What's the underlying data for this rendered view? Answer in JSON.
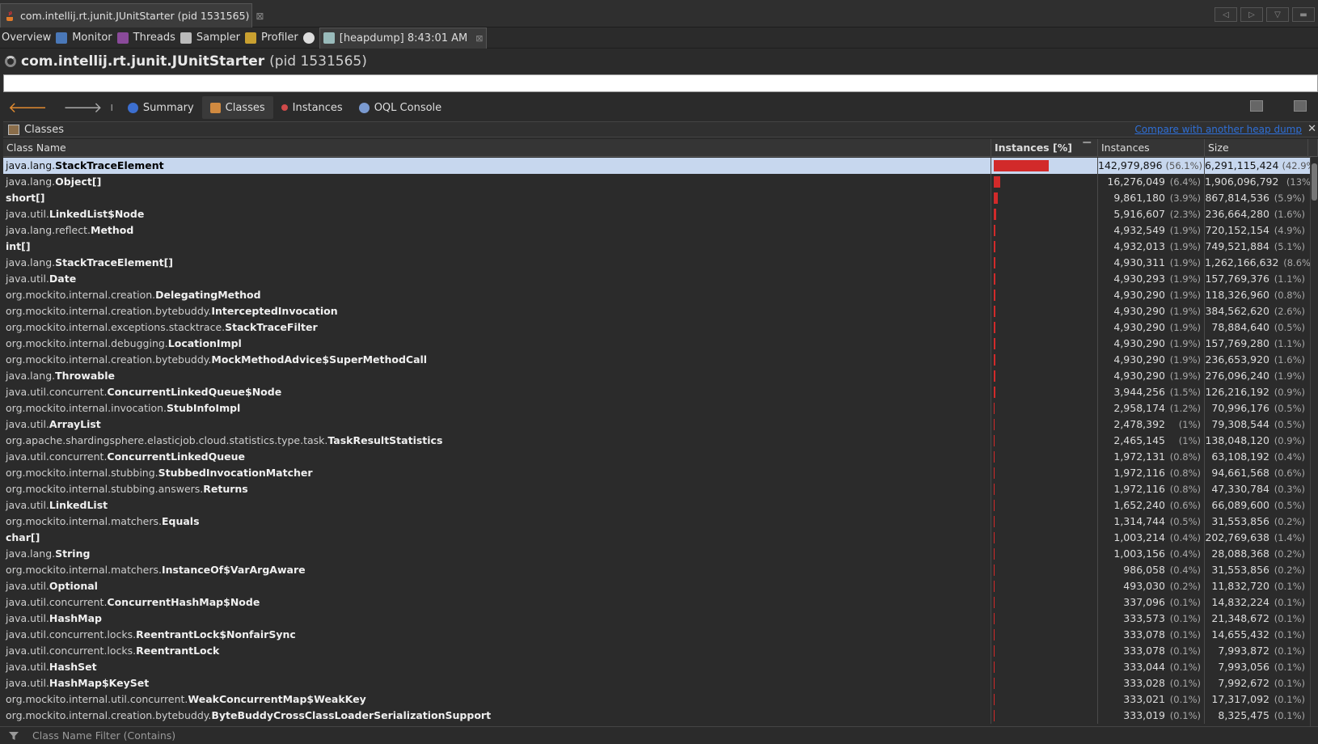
{
  "window_tab": {
    "title": "com.intellij.rt.junit.JUnitStarter (pid 1531565)",
    "close": "⊠"
  },
  "subtabs": [
    {
      "label": "Overview",
      "icon": "overview-icon"
    },
    {
      "label": "Monitor",
      "icon": "monitor-icon"
    },
    {
      "label": "Threads",
      "icon": "threads-icon"
    },
    {
      "label": "Sampler",
      "icon": "sampler-icon"
    },
    {
      "label": "Profiler",
      "icon": "profiler-icon"
    },
    {
      "label": "[heapdump] 8:43:01 AM",
      "icon": "heapdump-icon",
      "close": "⊠"
    }
  ],
  "title": {
    "main": "com.intellij.rt.junit.JUnitStarter",
    "pid": "(pid 1531565)"
  },
  "toolbar": {
    "sep": "I",
    "summary": "Summary",
    "classes": "Classes",
    "instances": "Instances",
    "oql": "OQL Console"
  },
  "classes_panel": {
    "title": "Classes",
    "compare_link": "Compare with another heap dump",
    "close": "✕"
  },
  "columns": {
    "name": "Class Name",
    "bar": "Instances [%]",
    "instances": "Instances",
    "size": "Size",
    "sort": "▔"
  },
  "filter_placeholder": "Class Name Filter (Contains)",
  "accent_color": "#d22a2a",
  "rows": [
    {
      "pkg": "java.lang.",
      "cls": "StackTraceElement",
      "pct": 56.1,
      "inst": "142,979,896",
      "ipct": "(56.1%)",
      "size": "6,291,115,424",
      "spct": "(42.9%)"
    },
    {
      "pkg": "java.lang.",
      "cls": "Object[]",
      "pct": 6.4,
      "inst": "16,276,049",
      "ipct": "(6.4%)",
      "size": "1,906,096,792",
      "spct": "(13%)"
    },
    {
      "pkg": "",
      "cls": "short[]",
      "pct": 3.9,
      "inst": "9,861,180",
      "ipct": "(3.9%)",
      "size": "867,814,536",
      "spct": "(5.9%)"
    },
    {
      "pkg": "java.util.",
      "cls": "LinkedList$Node",
      "pct": 2.3,
      "inst": "5,916,607",
      "ipct": "(2.3%)",
      "size": "236,664,280",
      "spct": "(1.6%)"
    },
    {
      "pkg": "java.lang.reflect.",
      "cls": "Method",
      "pct": 1.9,
      "inst": "4,932,549",
      "ipct": "(1.9%)",
      "size": "720,152,154",
      "spct": "(4.9%)"
    },
    {
      "pkg": "",
      "cls": "int[]",
      "pct": 1.9,
      "inst": "4,932,013",
      "ipct": "(1.9%)",
      "size": "749,521,884",
      "spct": "(5.1%)"
    },
    {
      "pkg": "java.lang.",
      "cls": "StackTraceElement[]",
      "pct": 1.9,
      "inst": "4,930,311",
      "ipct": "(1.9%)",
      "size": "1,262,166,632",
      "spct": "(8.6%)"
    },
    {
      "pkg": "java.util.",
      "cls": "Date",
      "pct": 1.9,
      "inst": "4,930,293",
      "ipct": "(1.9%)",
      "size": "157,769,376",
      "spct": "(1.1%)"
    },
    {
      "pkg": "org.mockito.internal.creation.",
      "cls": "DelegatingMethod",
      "pct": 1.9,
      "inst": "4,930,290",
      "ipct": "(1.9%)",
      "size": "118,326,960",
      "spct": "(0.8%)"
    },
    {
      "pkg": "org.mockito.internal.creation.bytebuddy.",
      "cls": "InterceptedInvocation",
      "pct": 1.9,
      "inst": "4,930,290",
      "ipct": "(1.9%)",
      "size": "384,562,620",
      "spct": "(2.6%)"
    },
    {
      "pkg": "org.mockito.internal.exceptions.stacktrace.",
      "cls": "StackTraceFilter",
      "pct": 1.9,
      "inst": "4,930,290",
      "ipct": "(1.9%)",
      "size": "78,884,640",
      "spct": "(0.5%)"
    },
    {
      "pkg": "org.mockito.internal.debugging.",
      "cls": "LocationImpl",
      "pct": 1.9,
      "inst": "4,930,290",
      "ipct": "(1.9%)",
      "size": "157,769,280",
      "spct": "(1.1%)"
    },
    {
      "pkg": "org.mockito.internal.creation.bytebuddy.",
      "cls": "MockMethodAdvice$SuperMethodCall",
      "pct": 1.9,
      "inst": "4,930,290",
      "ipct": "(1.9%)",
      "size": "236,653,920",
      "spct": "(1.6%)"
    },
    {
      "pkg": "java.lang.",
      "cls": "Throwable",
      "pct": 1.9,
      "inst": "4,930,290",
      "ipct": "(1.9%)",
      "size": "276,096,240",
      "spct": "(1.9%)"
    },
    {
      "pkg": "java.util.concurrent.",
      "cls": "ConcurrentLinkedQueue$Node",
      "pct": 1.5,
      "inst": "3,944,256",
      "ipct": "(1.5%)",
      "size": "126,216,192",
      "spct": "(0.9%)"
    },
    {
      "pkg": "org.mockito.internal.invocation.",
      "cls": "StubInfoImpl",
      "pct": 1.2,
      "inst": "2,958,174",
      "ipct": "(1.2%)",
      "size": "70,996,176",
      "spct": "(0.5%)"
    },
    {
      "pkg": "java.util.",
      "cls": "ArrayList",
      "pct": 1.0,
      "inst": "2,478,392",
      "ipct": "(1%)",
      "size": "79,308,544",
      "spct": "(0.5%)"
    },
    {
      "pkg": "org.apache.shardingsphere.elasticjob.cloud.statistics.type.task.",
      "cls": "TaskResultStatistics",
      "pct": 1.0,
      "inst": "2,465,145",
      "ipct": "(1%)",
      "size": "138,048,120",
      "spct": "(0.9%)"
    },
    {
      "pkg": "java.util.concurrent.",
      "cls": "ConcurrentLinkedQueue",
      "pct": 0.8,
      "inst": "1,972,131",
      "ipct": "(0.8%)",
      "size": "63,108,192",
      "spct": "(0.4%)"
    },
    {
      "pkg": "org.mockito.internal.stubbing.",
      "cls": "StubbedInvocationMatcher",
      "pct": 0.8,
      "inst": "1,972,116",
      "ipct": "(0.8%)",
      "size": "94,661,568",
      "spct": "(0.6%)"
    },
    {
      "pkg": "org.mockito.internal.stubbing.answers.",
      "cls": "Returns",
      "pct": 0.8,
      "inst": "1,972,116",
      "ipct": "(0.8%)",
      "size": "47,330,784",
      "spct": "(0.3%)"
    },
    {
      "pkg": "java.util.",
      "cls": "LinkedList",
      "pct": 0.6,
      "inst": "1,652,240",
      "ipct": "(0.6%)",
      "size": "66,089,600",
      "spct": "(0.5%)"
    },
    {
      "pkg": "org.mockito.internal.matchers.",
      "cls": "Equals",
      "pct": 0.5,
      "inst": "1,314,744",
      "ipct": "(0.5%)",
      "size": "31,553,856",
      "spct": "(0.2%)"
    },
    {
      "pkg": "",
      "cls": "char[]",
      "pct": 0.4,
      "inst": "1,003,214",
      "ipct": "(0.4%)",
      "size": "202,769,638",
      "spct": "(1.4%)"
    },
    {
      "pkg": "java.lang.",
      "cls": "String",
      "pct": 0.4,
      "inst": "1,003,156",
      "ipct": "(0.4%)",
      "size": "28,088,368",
      "spct": "(0.2%)"
    },
    {
      "pkg": "org.mockito.internal.matchers.",
      "cls": "InstanceOf$VarArgAware",
      "pct": 0.4,
      "inst": "986,058",
      "ipct": "(0.4%)",
      "size": "31,553,856",
      "spct": "(0.2%)"
    },
    {
      "pkg": "java.util.",
      "cls": "Optional",
      "pct": 0.2,
      "inst": "493,030",
      "ipct": "(0.2%)",
      "size": "11,832,720",
      "spct": "(0.1%)"
    },
    {
      "pkg": "java.util.concurrent.",
      "cls": "ConcurrentHashMap$Node",
      "pct": 0.1,
      "inst": "337,096",
      "ipct": "(0.1%)",
      "size": "14,832,224",
      "spct": "(0.1%)"
    },
    {
      "pkg": "java.util.",
      "cls": "HashMap",
      "pct": 0.1,
      "inst": "333,573",
      "ipct": "(0.1%)",
      "size": "21,348,672",
      "spct": "(0.1%)"
    },
    {
      "pkg": "java.util.concurrent.locks.",
      "cls": "ReentrantLock$NonfairSync",
      "pct": 0.1,
      "inst": "333,078",
      "ipct": "(0.1%)",
      "size": "14,655,432",
      "spct": "(0.1%)"
    },
    {
      "pkg": "java.util.concurrent.locks.",
      "cls": "ReentrantLock",
      "pct": 0.1,
      "inst": "333,078",
      "ipct": "(0.1%)",
      "size": "7,993,872",
      "spct": "(0.1%)"
    },
    {
      "pkg": "java.util.",
      "cls": "HashSet",
      "pct": 0.1,
      "inst": "333,044",
      "ipct": "(0.1%)",
      "size": "7,993,056",
      "spct": "(0.1%)"
    },
    {
      "pkg": "java.util.",
      "cls": "HashMap$KeySet",
      "pct": 0.1,
      "inst": "333,028",
      "ipct": "(0.1%)",
      "size": "7,992,672",
      "spct": "(0.1%)"
    },
    {
      "pkg": "org.mockito.internal.util.concurrent.",
      "cls": "WeakConcurrentMap$WeakKey",
      "pct": 0.1,
      "inst": "333,021",
      "ipct": "(0.1%)",
      "size": "17,317,092",
      "spct": "(0.1%)"
    },
    {
      "pkg": "org.mockito.internal.creation.bytebuddy.",
      "cls": "ByteBuddyCrossClassLoaderSerializationSupport",
      "pct": 0.1,
      "inst": "333,019",
      "ipct": "(0.1%)",
      "size": "8,325,475",
      "spct": "(0.1%)"
    }
  ]
}
